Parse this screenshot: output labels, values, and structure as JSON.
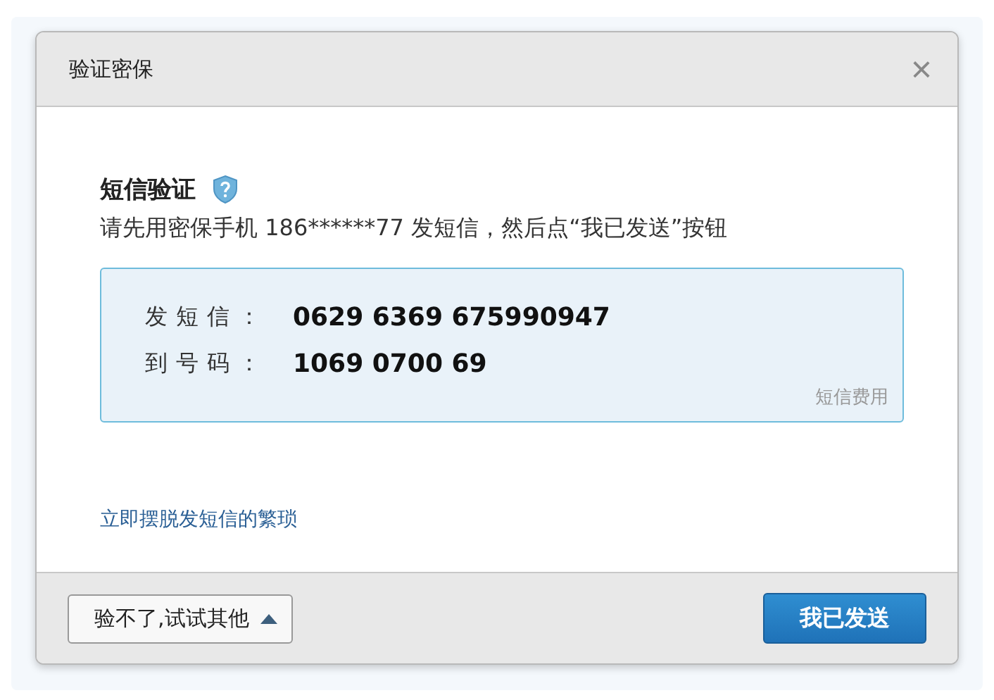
{
  "dialog": {
    "title": "验证密保",
    "close": "×"
  },
  "section": {
    "heading": "短信验证",
    "instruction": "请先用密保手机 186******77 发短信，然后点“我已发送”按钮"
  },
  "sms_box": {
    "rows": [
      {
        "label": "发短信：",
        "value": "0629 6369 675990947"
      },
      {
        "label": "到号码：",
        "value": "1069 0700 69"
      }
    ],
    "fee_link": "短信费用"
  },
  "skip_link": "立即摆脱发短信的繁琐",
  "footer": {
    "other_button": "验不了,试试其他",
    "confirm_button": "我已发送"
  }
}
